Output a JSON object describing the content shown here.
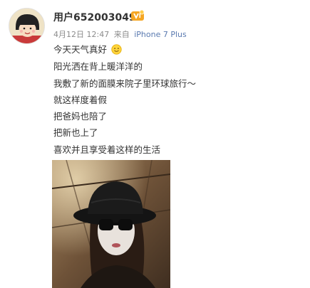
{
  "post": {
    "username": "用户6520030499",
    "date": "4月12日 12:47",
    "via": "来自",
    "source": "iPhone 7 Plus",
    "lines": [
      "今天天气真好",
      "阳光洒在背上暖洋洋的",
      "我敷了新的面膜来院子里环球旅行～",
      "就这样度着假",
      "把爸妈也陪了",
      "把新也上了",
      "喜欢并且享受着这样的生活"
    ],
    "emoji": "smile-icon",
    "badge": "vip-icon"
  },
  "colors": {
    "name": "#333333",
    "meta": "#8c8c8c",
    "source": "#5a7ab0",
    "badge": "#f5a623"
  }
}
